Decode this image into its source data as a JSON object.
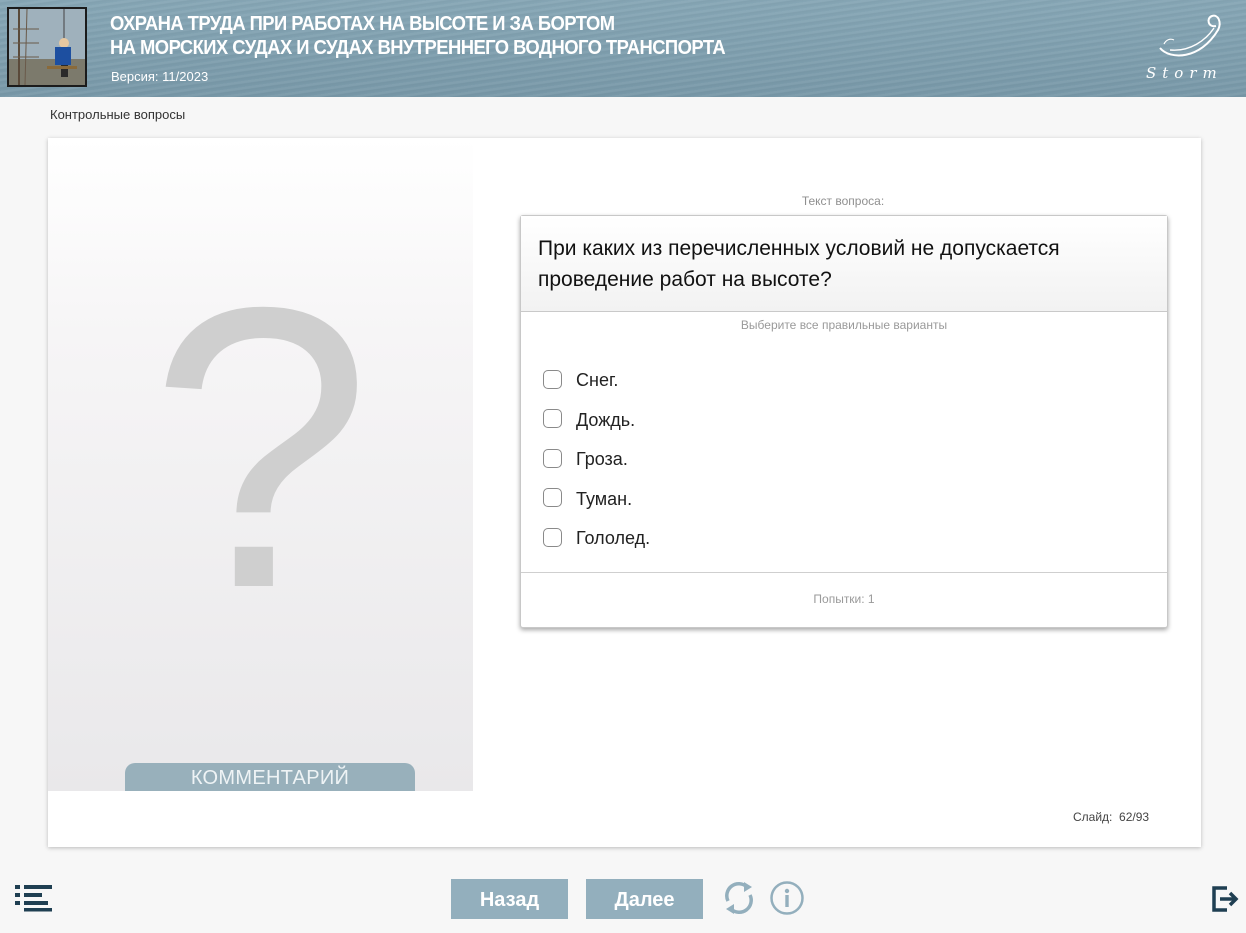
{
  "header": {
    "title_line1": "ОХРАНА ТРУДА ПРИ РАБОТАХ НА ВЫСОТЕ И ЗА БОРТОМ",
    "title_line2": "НА МОРСКИХ СУДАХ И СУДАХ ВНУТРЕННЕГО ВОДНОГО ТРАНСПОРТА",
    "version": "Версия: 11/2023",
    "logo_text": "Storm"
  },
  "breadcrumb": "Контрольные вопросы",
  "left_panel": {
    "placeholder_symbol": "?",
    "comment_button": "КОММЕНТАРИЙ"
  },
  "question": {
    "label": "Текст вопроса:",
    "text": "При каких из перечисленных условий не допускается проведение работ на высоте?",
    "hint": "Выберите все правильные варианты",
    "options": [
      {
        "label": "Снег.",
        "checked": false
      },
      {
        "label": "Дождь.",
        "checked": false
      },
      {
        "label": "Гроза.",
        "checked": false
      },
      {
        "label": "Туман.",
        "checked": false
      },
      {
        "label": "Гололед.",
        "checked": false
      }
    ],
    "attempts": "Попытки: 1"
  },
  "slide_counter": "Слайд:  62/93",
  "nav": {
    "back": "Назад",
    "next": "Далее"
  },
  "colors": {
    "header_bg": "#7f9fae",
    "button_bg": "#93afbd",
    "icon_color": "#1f3f52"
  }
}
